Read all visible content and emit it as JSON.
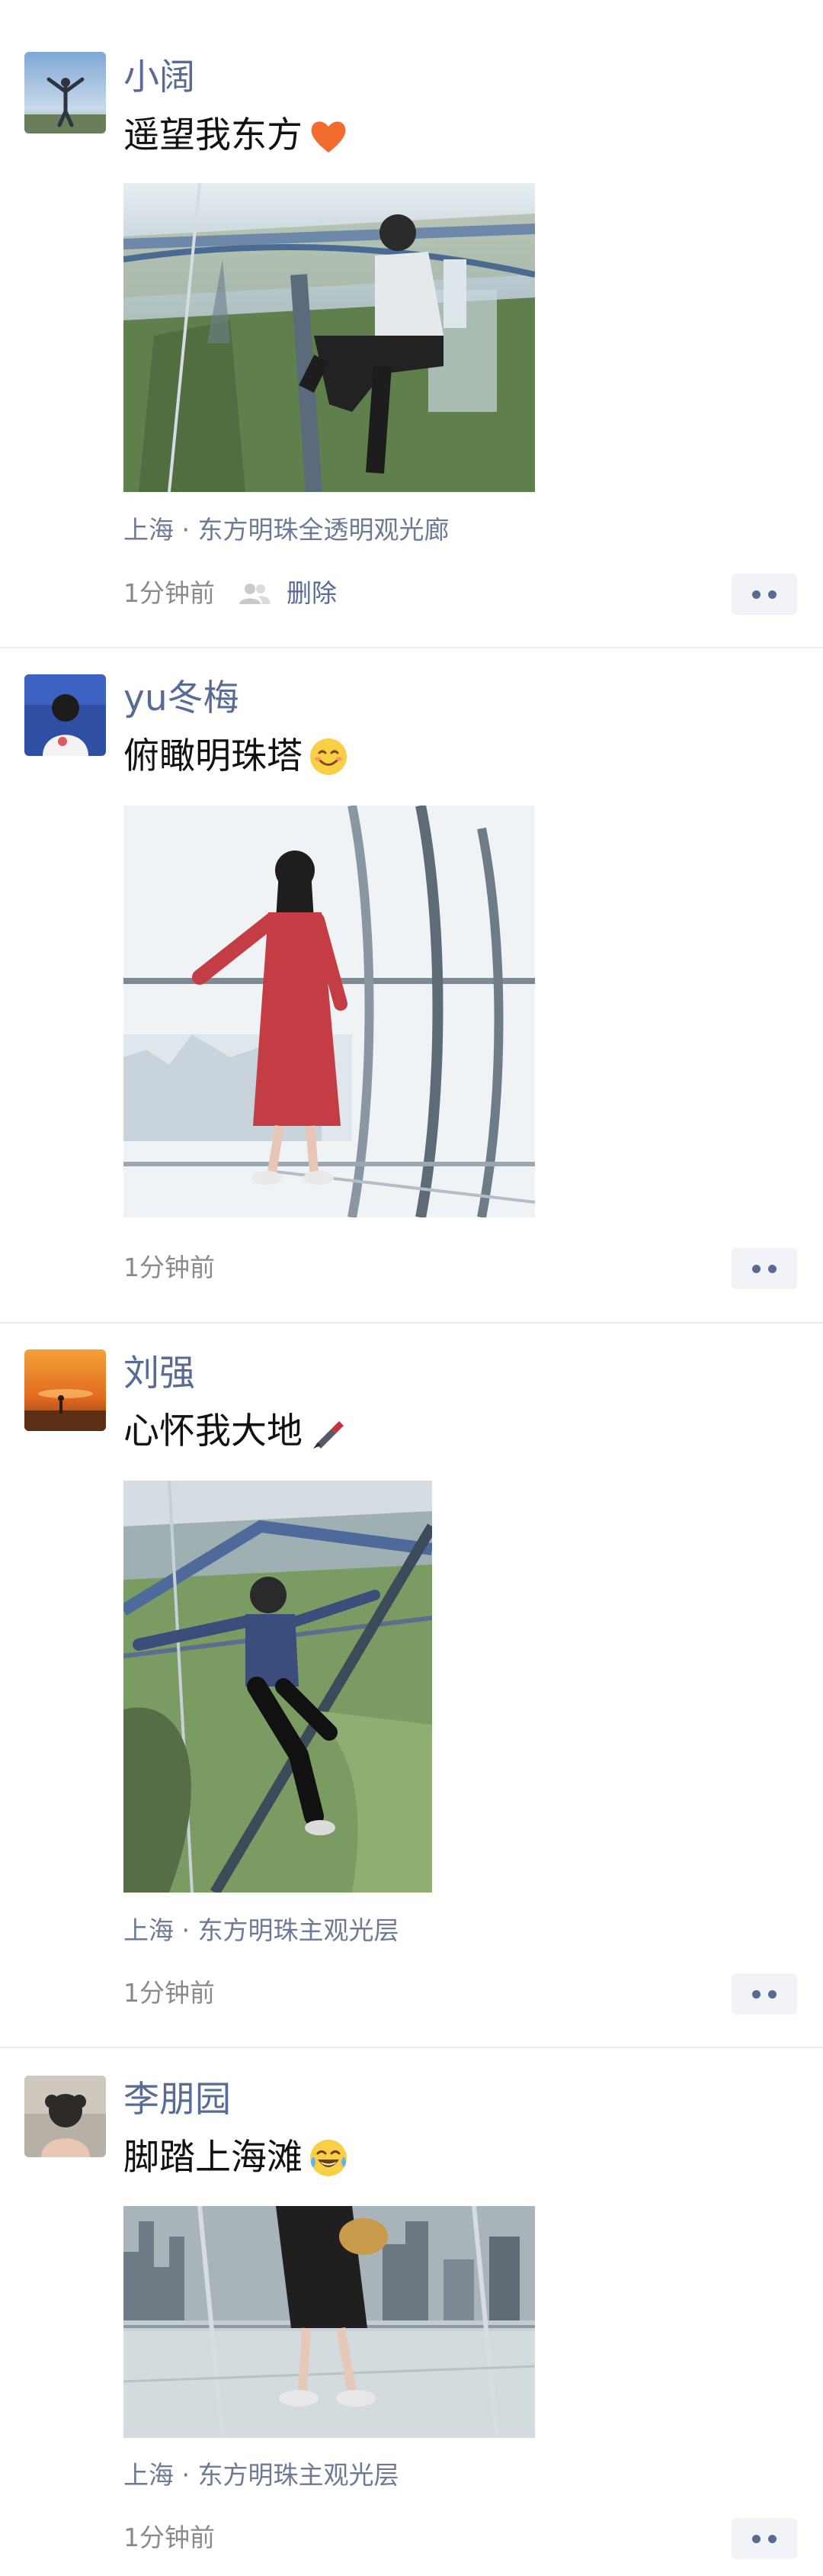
{
  "posts": [
    {
      "username": "小阔",
      "caption": "遥望我东方",
      "emoji": "orange-heart-icon",
      "location": "上海 · 东方明珠全透明观光廊",
      "time": "1分钟前",
      "delete_label": "删除"
    },
    {
      "username": "yu冬梅",
      "caption": "俯瞰明珠塔",
      "emoji": "smiling-face-icon",
      "location": "",
      "time": "1分钟前"
    },
    {
      "username": "刘强",
      "caption": "心怀我大地",
      "emoji": "paintbrush-icon",
      "location": "上海 · 东方明珠主观光层",
      "time": "1分钟前"
    },
    {
      "username": "李朋园",
      "caption": "脚踏上海滩",
      "emoji": "tears-of-joy-icon",
      "location": "上海 · 东方明珠主观光层",
      "time": "1分钟前"
    }
  ],
  "colors": {
    "link": "#576b95",
    "location": "#6c7a96",
    "time": "#8a8a8a",
    "more_bg": "#f2f3f6"
  }
}
